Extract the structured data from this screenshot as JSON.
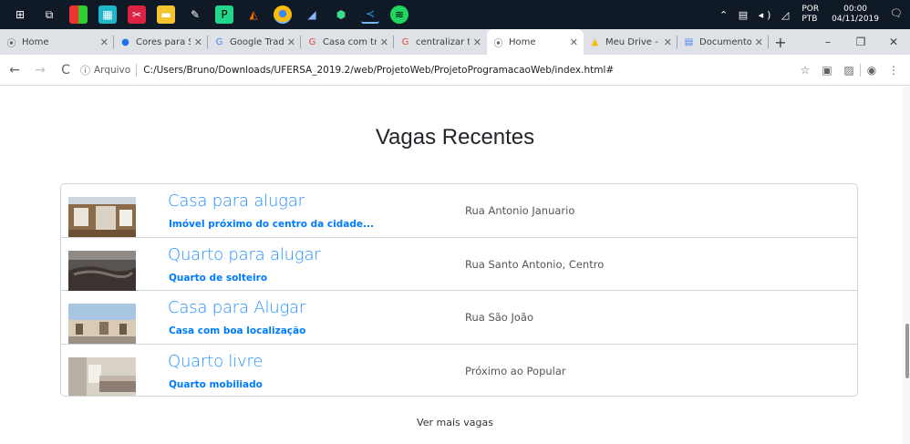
{
  "taskbar": {
    "icons": [
      "windows-start-icon",
      "task-view-icon",
      "app-tiles-icon",
      "calendar-app-icon",
      "snipping-tool-icon",
      "folder-icon",
      "paint-icon",
      "pycharm-icon",
      "matlab-icon",
      "chrome-icon",
      "edge-like-icon",
      "android-studio-icon",
      "vscode-icon",
      "spotify-icon"
    ],
    "tray_icons": "⌃ ▤ ◂) ◿",
    "lang_top": "POR",
    "lang_bottom": "PTB",
    "time": "00:00",
    "date": "04/11/2019",
    "notif_count": "2"
  },
  "tabs": [
    {
      "label": "Home",
      "icon": "⦿",
      "icon_color": "#5f6368",
      "active": false
    },
    {
      "label": "Cores para Site",
      "icon": "●",
      "icon_color": "#1a73e8",
      "active": false
    },
    {
      "label": "Google Tradutor",
      "icon": "G",
      "icon_color": "#4285f4",
      "active": false
    },
    {
      "label": "Casa com três",
      "icon": "G",
      "icon_color": "#ea4335",
      "active": false
    },
    {
      "label": "centralizar text",
      "icon": "G",
      "icon_color": "#ea4335",
      "active": false
    },
    {
      "label": "Home",
      "icon": "⦿",
      "icon_color": "#5f6368",
      "active": true
    },
    {
      "label": "Meu Drive - G",
      "icon": "▲",
      "icon_color": "#fbbc04",
      "active": false
    },
    {
      "label": "Documento se",
      "icon": "▤",
      "icon_color": "#4285f4",
      "active": false
    }
  ],
  "window_controls": {
    "minimize": "–",
    "maximize": "❐",
    "close": "✕"
  },
  "address": {
    "scheme_label": "Arquivo",
    "url": "C:/Users/Bruno/Downloads/UFERSA_2019.2/web/ProjetoWeb/ProjetoProgramacaoWeb/index.html#"
  },
  "page": {
    "heading": "Vagas Recentes",
    "listings": [
      {
        "title": "Casa para alugar",
        "subtitle": "Imóvel próximo do centro da cidade...",
        "address": "Rua Antonio Januario"
      },
      {
        "title": "Quarto para alugar",
        "subtitle": "Quarto de solteiro",
        "address": "Rua Santo Antonio, Centro"
      },
      {
        "title": "Casa para Alugar",
        "subtitle": "Casa com boa localização",
        "address": "Rua São João"
      },
      {
        "title": "Quarto livre",
        "subtitle": "Quarto mobiliado",
        "address": "Próximo ao Popular"
      }
    ],
    "more_link": "Ver mais vagas"
  }
}
